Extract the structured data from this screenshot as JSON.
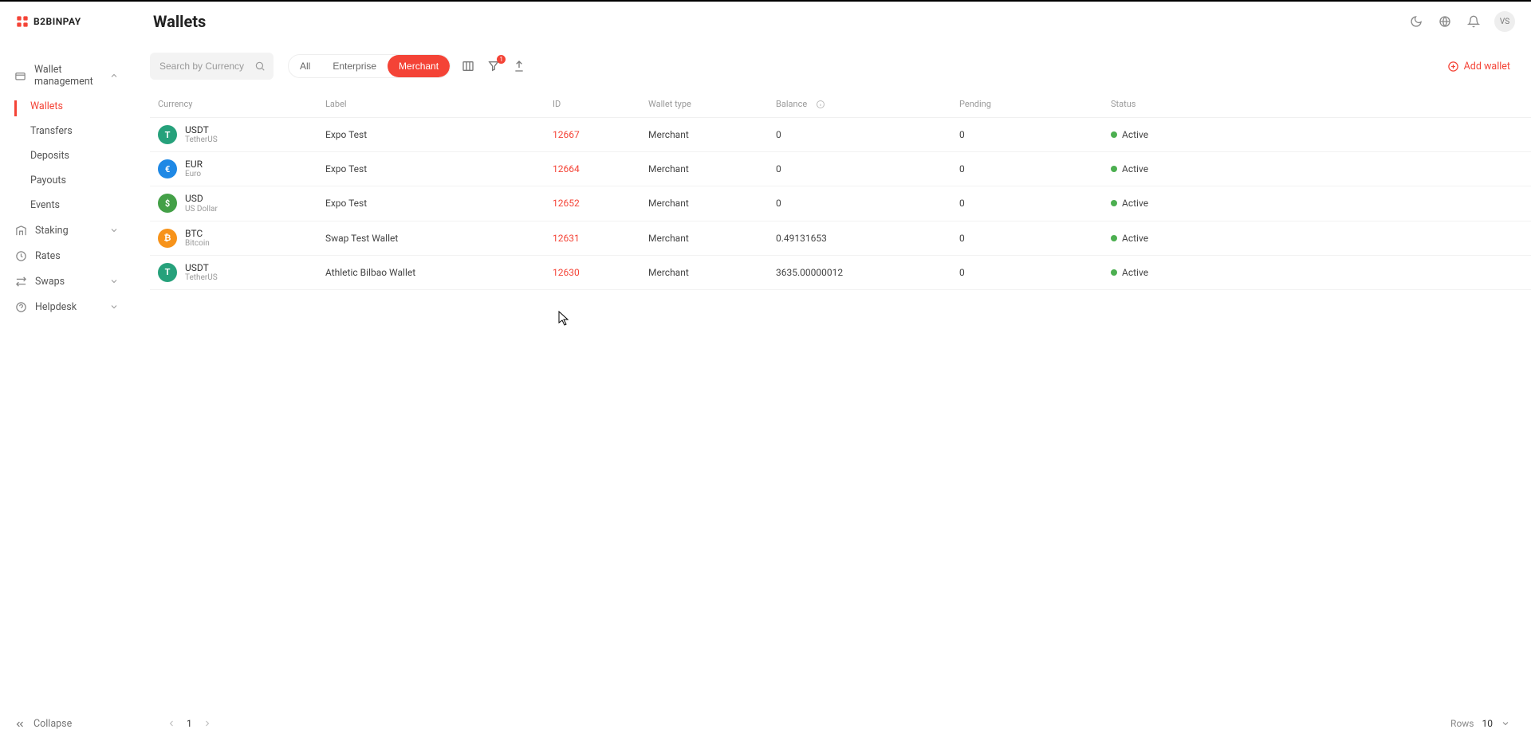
{
  "brand": "B2BINPAY",
  "page_title": "Wallets",
  "user_initials": "VS",
  "sidebar": {
    "sections": [
      {
        "label": "Wallet management",
        "expanded": true,
        "children": [
          {
            "label": "Wallets",
            "active": true
          },
          {
            "label": "Transfers"
          },
          {
            "label": "Deposits"
          },
          {
            "label": "Payouts"
          },
          {
            "label": "Events"
          }
        ]
      },
      {
        "label": "Staking",
        "expandable": true
      },
      {
        "label": "Rates"
      },
      {
        "label": "Swaps",
        "expandable": true
      },
      {
        "label": "Helpdesk",
        "expandable": true
      }
    ],
    "collapse_label": "Collapse"
  },
  "toolbar": {
    "search_placeholder": "Search by Currency",
    "filters": {
      "all": "All",
      "enterprise": "Enterprise",
      "merchant": "Merchant",
      "active": "merchant"
    },
    "filter_badge": "1",
    "add_wallet": "Add wallet"
  },
  "table": {
    "headers": {
      "currency": "Currency",
      "label": "Label",
      "id": "ID",
      "type": "Wallet type",
      "balance": "Balance",
      "pending": "Pending",
      "status": "Status"
    },
    "rows": [
      {
        "sym": "USDT",
        "name": "TetherUS",
        "bg": "#26a17b",
        "ic": "T",
        "label": "Expo Test",
        "id": "12667",
        "type": "Merchant",
        "balance": "0",
        "pending": "0",
        "status": "Active"
      },
      {
        "sym": "EUR",
        "name": "Euro",
        "bg": "#1e88e5",
        "ic": "€",
        "label": "Expo Test",
        "id": "12664",
        "type": "Merchant",
        "balance": "0",
        "pending": "0",
        "status": "Active"
      },
      {
        "sym": "USD",
        "name": "US Dollar",
        "bg": "#43a047",
        "ic": "$",
        "label": "Expo Test",
        "id": "12652",
        "type": "Merchant",
        "balance": "0",
        "pending": "0",
        "status": "Active"
      },
      {
        "sym": "BTC",
        "name": "Bitcoin",
        "bg": "#f7931a",
        "ic": "₿",
        "label": "Swap Test Wallet",
        "id": "12631",
        "type": "Merchant",
        "balance": "0.49131653",
        "pending": "0",
        "status": "Active"
      },
      {
        "sym": "USDT",
        "name": "TetherUS",
        "bg": "#26a17b",
        "ic": "T",
        "label": "Athletic Bilbao Wallet",
        "id": "12630",
        "type": "Merchant",
        "balance": "3635.00000012",
        "pending": "0",
        "status": "Active"
      }
    ]
  },
  "pagination": {
    "current": "1",
    "rows_label": "Rows",
    "rows_value": "10"
  }
}
